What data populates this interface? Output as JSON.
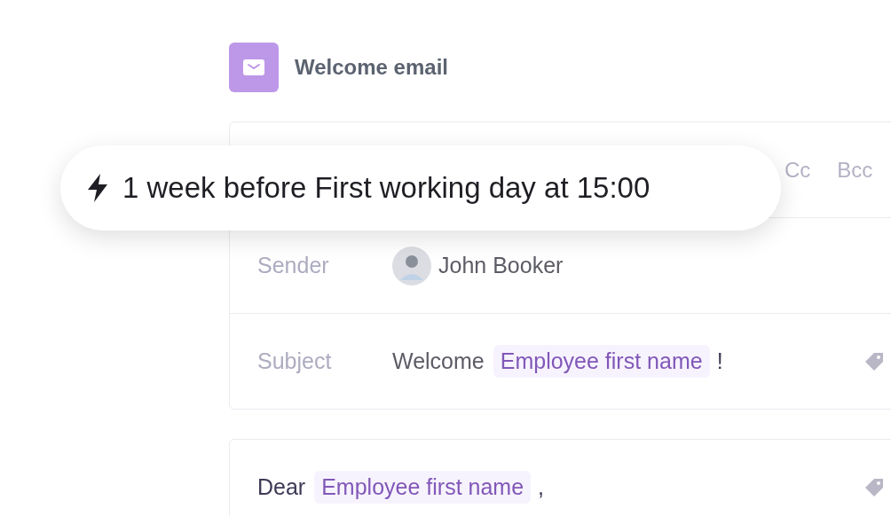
{
  "title": "Welcome email",
  "trigger": {
    "text": "1 week before First working day at 15:00"
  },
  "recipients": {
    "cc": "Cc",
    "bcc": "Bcc"
  },
  "sender": {
    "label": "Sender",
    "name": "John Booker"
  },
  "subject": {
    "label": "Subject",
    "text": "Welcome",
    "variable": "Employee first name",
    "suffix": "!"
  },
  "body": {
    "text": "Dear",
    "variable": "Employee first name",
    "suffix": ","
  }
}
